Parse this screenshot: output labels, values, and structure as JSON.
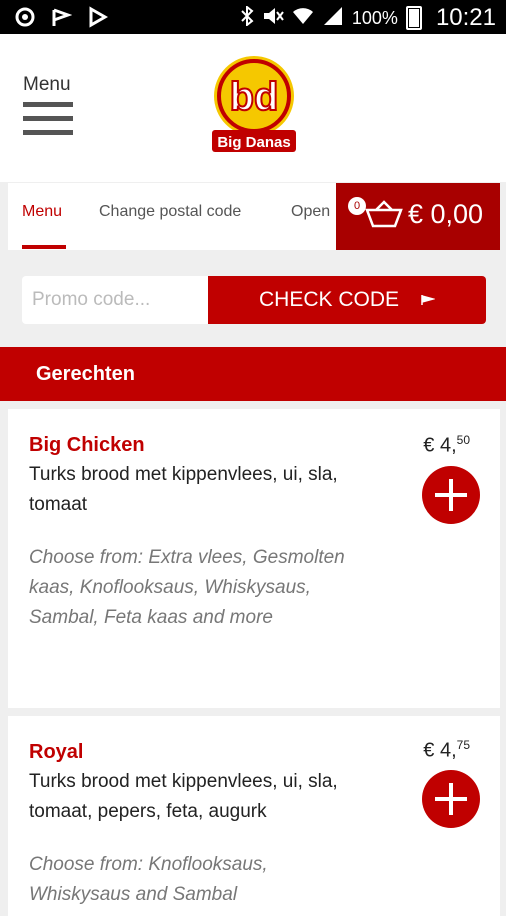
{
  "status_bar": {
    "battery": "100%",
    "time": "10:21"
  },
  "header": {
    "menu_label": "Menu",
    "logo_text": "Big Danas",
    "logo_mark": "bd"
  },
  "tabs": [
    {
      "label": "Menu",
      "active": true
    },
    {
      "label": "Change postal code",
      "active": false
    },
    {
      "label": "Open",
      "active": false
    }
  ],
  "cart": {
    "count": "0",
    "price": "€ 0,00"
  },
  "promo": {
    "placeholder": "Promo code...",
    "button_label": "CHECK CODE"
  },
  "section": {
    "title": "Gerechten"
  },
  "items": [
    {
      "name": "Big Chicken",
      "price_main": "€ 4,",
      "price_cents": "50",
      "description": "Turks brood met kippenvlees, ui, sla, tomaat",
      "choose": "Choose from: Extra vlees, Gesmolten kaas, Knoflooksaus, Whiskysaus, Sambal, Feta kaas and more"
    },
    {
      "name": "Royal",
      "price_main": "€ 4,",
      "price_cents": "75",
      "description": "Turks brood met kippenvlees, ui, sla, tomaat, pepers, feta, augurk",
      "choose": "Choose from: Knoflooksaus, Whiskysaus and Sambal"
    }
  ],
  "colors": {
    "brand_red": "#c00000",
    "cart_red": "#a80000",
    "logo_yellow": "#f5c800"
  }
}
